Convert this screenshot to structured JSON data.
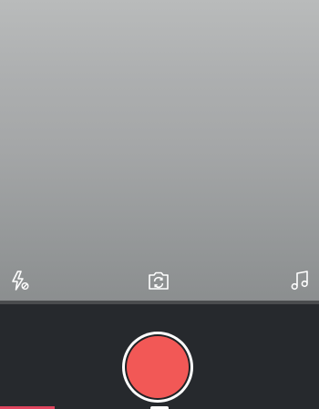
{
  "camera": {
    "flash_icon": "flash-off-icon",
    "switch_camera_icon": "switch-camera-icon",
    "music_icon": "music-note-icon"
  },
  "record": {
    "button_color": "#f25856",
    "ring_color": "#ffffff"
  },
  "progress": {
    "fraction": 0.17,
    "color": "#e0445e"
  },
  "theme": {
    "controls_background": "#26292d"
  }
}
